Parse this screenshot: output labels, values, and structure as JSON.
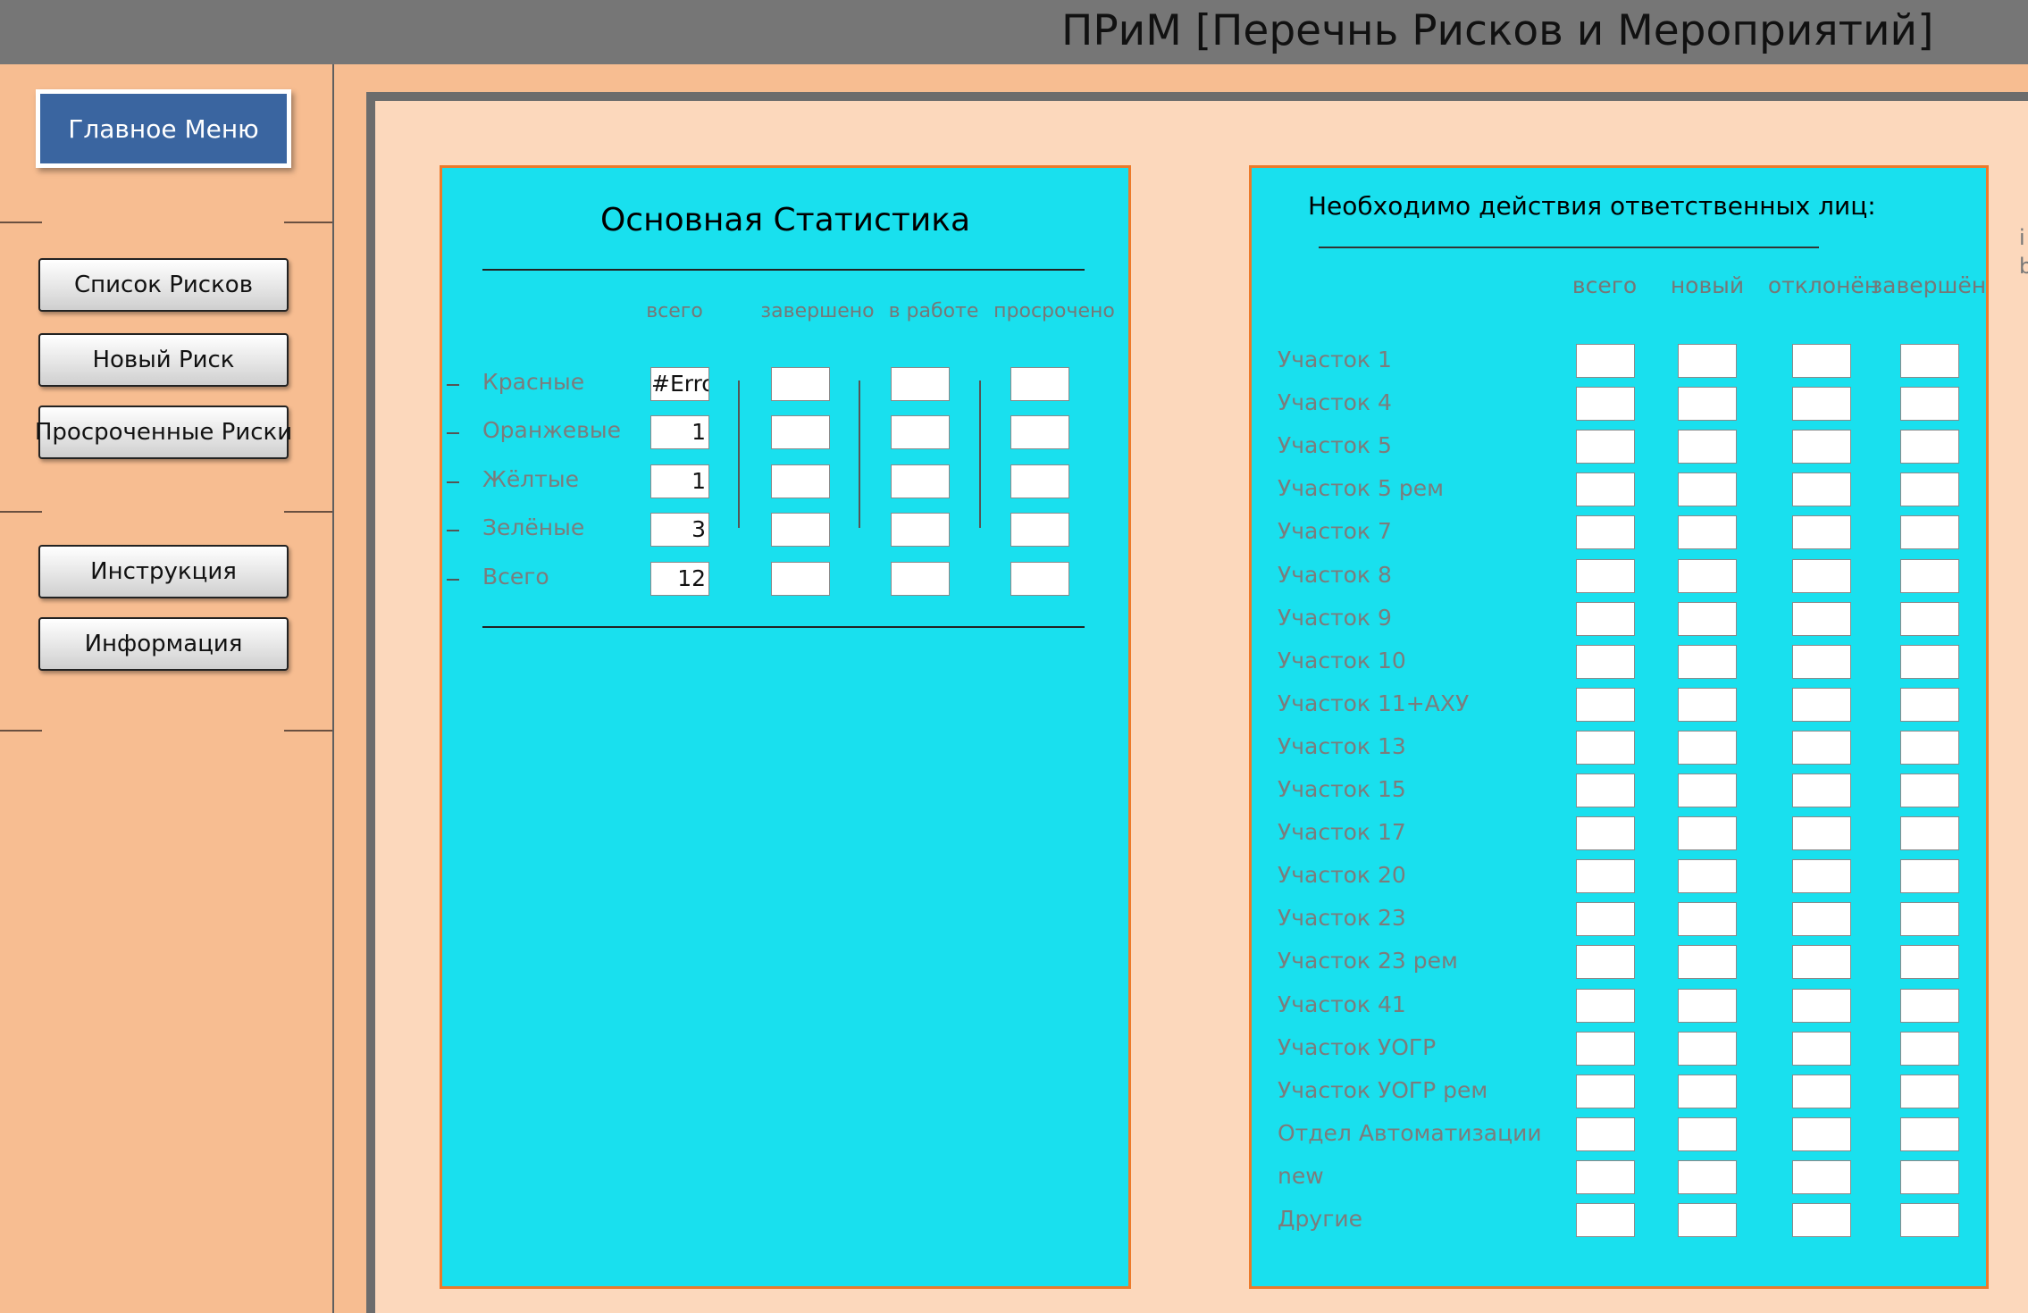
{
  "app": {
    "title": "ПРиМ [Перечнь Рисков и Мероприятий]"
  },
  "sidebar": {
    "main_menu": "Главное Меню",
    "buttons": [
      {
        "label": "Список Рисков"
      },
      {
        "label": "Новый Риск"
      },
      {
        "label": "Просроченные Риски"
      },
      {
        "label": "Инструкция"
      },
      {
        "label": "Информация"
      }
    ]
  },
  "stats": {
    "title": "Основная Статистика",
    "columns": [
      "всего",
      "завершено",
      "в работе",
      "просрочено"
    ],
    "rows": [
      {
        "label": "Красные",
        "total": "#Error"
      },
      {
        "label": "Оранжевые",
        "total": "1"
      },
      {
        "label": "Жёлтые",
        "total": "1"
      },
      {
        "label": "Зелёные",
        "total": "3"
      },
      {
        "label": "Всего",
        "total": "12"
      }
    ]
  },
  "actions": {
    "title": "Необходимо действия ответственных лиц:",
    "columns": [
      "всего",
      "новый",
      "отклонён",
      "завершён"
    ],
    "rows": [
      "Участок 1",
      "Участок 4",
      "Участок 5",
      "Участок 5 рем",
      "Участок 7",
      "Участок 8",
      "Участок 9",
      "Участок 10",
      "Участок 11+АХУ",
      "Участок 13",
      "Участок 15",
      "Участок 17",
      "Участок 20",
      "Участок 23",
      "Участок 23 рем",
      "Участок 41",
      "Участок УОГР",
      "Участок УОГР рем",
      "Отдел Автоматизации",
      "new",
      "Другие"
    ]
  },
  "edge_text": [
    "i",
    "b"
  ]
}
